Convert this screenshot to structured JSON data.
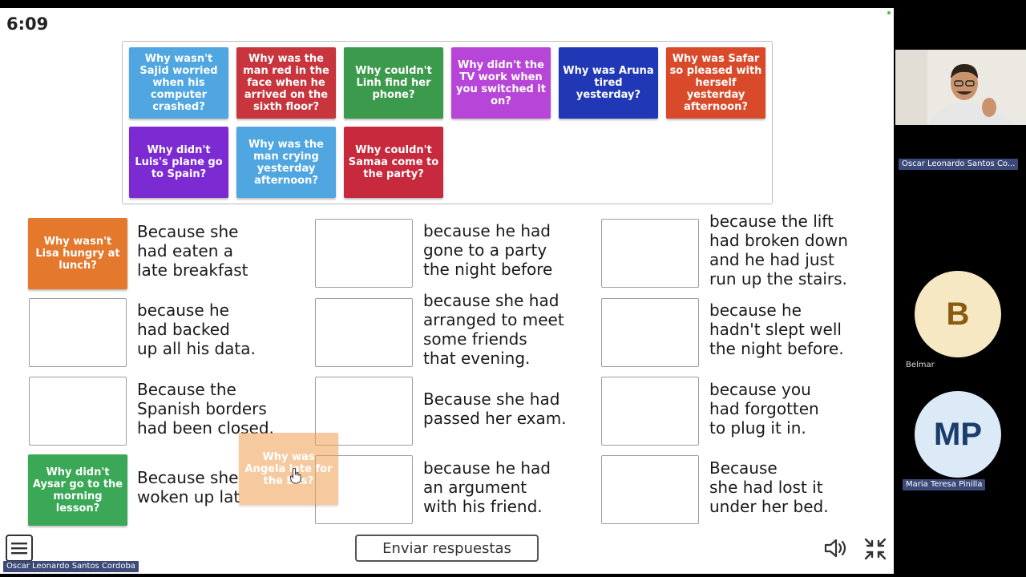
{
  "timer": "6:09",
  "bank_tiles": [
    {
      "text": "Why wasn't Sajid worried when his computer crashed?",
      "color": "#4fa6e0"
    },
    {
      "text": "Why was the man red in the face when he arrived on the sixth floor?",
      "color": "#c8353c"
    },
    {
      "text": "Why couldn't Linh find her phone?",
      "color": "#3c9a4d"
    },
    {
      "text": "Why didn't the TV work when you switched it on?",
      "color": "#b746d8"
    },
    {
      "text": "Why was Aruna tired yesterday?",
      "color": "#2038b5"
    },
    {
      "text": "Why was Safar so pleased with herself yesterday afternoon?",
      "color": "#d94a2a"
    },
    {
      "text": "Why didn't Luis's plane go to Spain?",
      "color": "#7c2bd3"
    },
    {
      "text": "Why was the man crying yesterday afternoon?",
      "color": "#4fa6e0"
    },
    {
      "text": "Why couldn't Samaa come to the party?",
      "color": "#c62a3c"
    }
  ],
  "placed": [
    {
      "text": "Why wasn't Lisa hungry at lunch?",
      "color": "#e4782c"
    },
    {
      "text": "Why didn't Aysar go to the morning lesson?",
      "color": "#3aa856"
    }
  ],
  "answers": [
    "Because she\nhad eaten a\nlate breakfast",
    "because he had\ngone to a party\nthe night before",
    "because the lift\nhad broken down\nand he had just\nrun up the stairs.",
    "because he\nhad backed\nup all his data.",
    "because she had\narranged to meet\nsome friends\nthat evening.",
    "because he\nhadn't slept well\nthe night before.",
    "Because the\nSpanish borders\nhad been closed.",
    "Because she had\npassed her exam.",
    "because you\nhad forgotten\nto plug it in.",
    "Because she had\nwoken up late.",
    "because he had\nan argument\nwith his friend.",
    "Because\nshe had lost it\nunder her bed."
  ],
  "dragging": {
    "text": "Why was Angela late for the bus?",
    "color": "#f0a050"
  },
  "submit_label": "Enviar respuestas",
  "participants": {
    "video_name": "Oscar Leonardo Santos Co...",
    "p1_initial": "B",
    "p1_name": "Belmar",
    "p1_color": "#f7e8c4",
    "p1_text_color": "#8a5a10",
    "p2_initial": "MP",
    "p2_name": "Maria Teresa Pinilla",
    "p2_color": "#dce9f7",
    "p2_text_color": "#1a3d6b",
    "self_name": "Oscar Leonardo Santos Cordoba"
  }
}
